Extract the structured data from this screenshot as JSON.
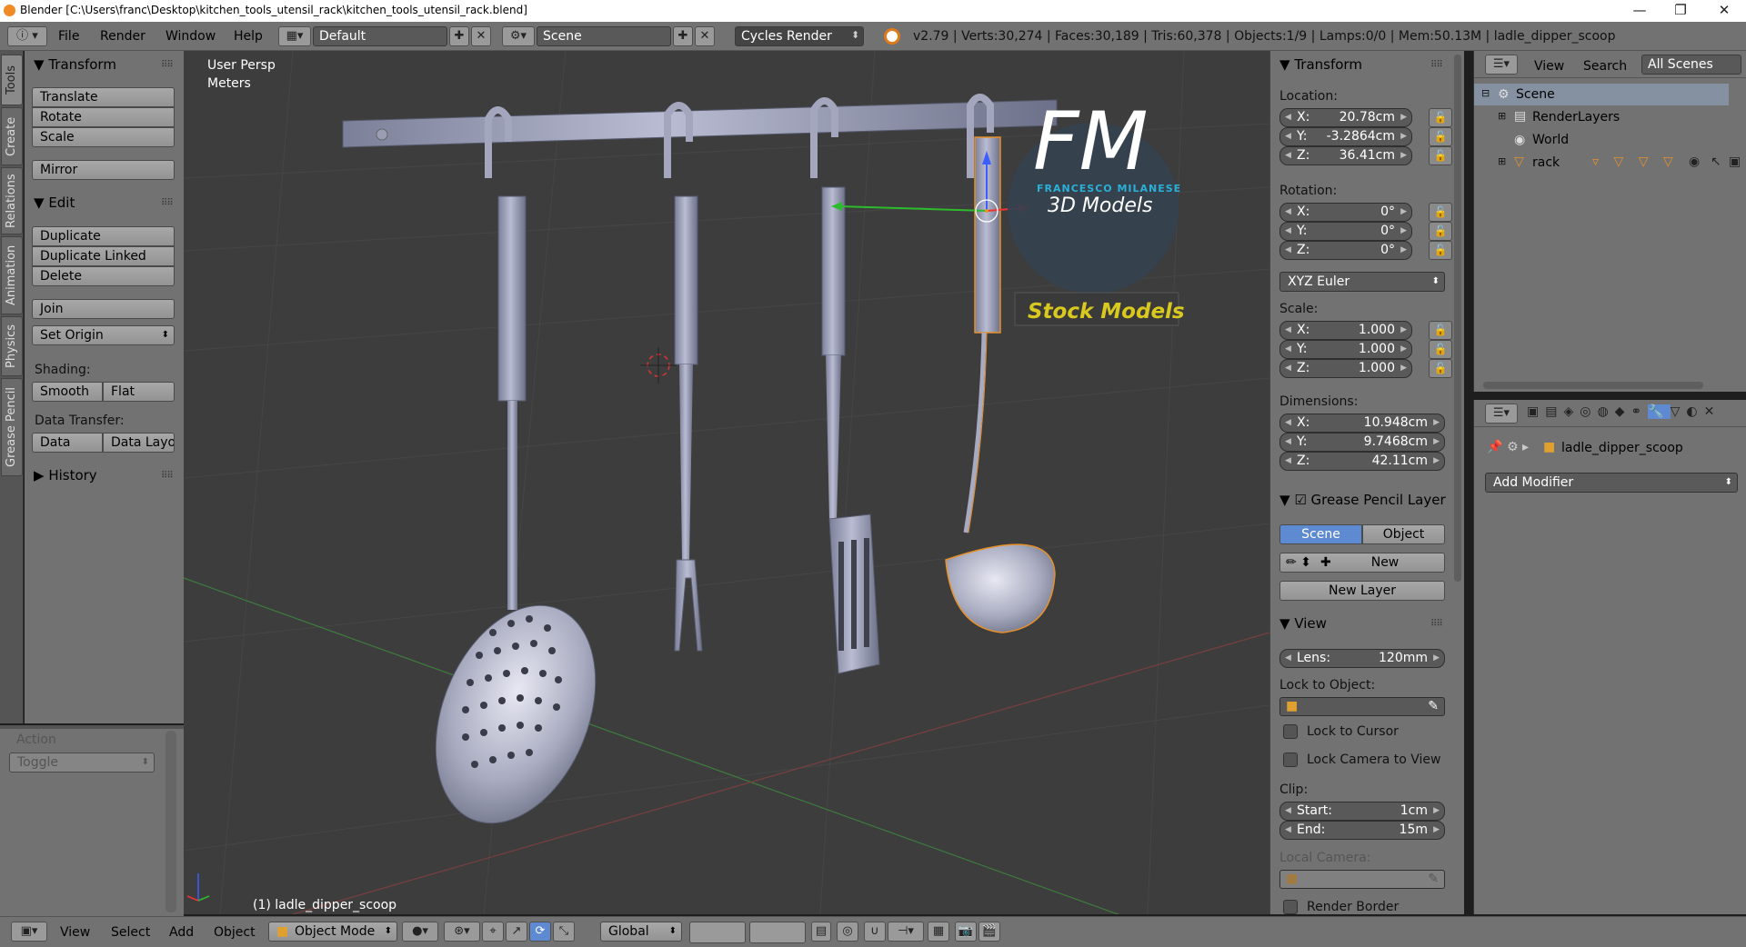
{
  "window": {
    "title": "Blender [C:\\Users\\franc\\Desktop\\kitchen_tools_utensil_rack\\kitchen_tools_utensil_rack.blend]",
    "controls": [
      "—",
      "❐",
      "✕"
    ]
  },
  "header": {
    "menus": [
      "File",
      "Render",
      "Window",
      "Help"
    ],
    "layout": "Default",
    "scene": "Scene",
    "engine": "Cycles Render",
    "stats": "v2.79 | Verts:30,274 | Faces:30,189 | Tris:60,378 | Objects:1/9 | Lamps:0/0 | Mem:50.13M | ladle_dipper_scoop"
  },
  "tabs": [
    "Tools",
    "Create",
    "Relations",
    "Animation",
    "Physics",
    "Grease Pencil"
  ],
  "toolshelf": {
    "transform_title": "Transform",
    "translate": "Translate",
    "rotate": "Rotate",
    "scale": "Scale",
    "mirror": "Mirror",
    "edit_title": "Edit",
    "duplicate": "Duplicate",
    "duplicate_linked": "Duplicate Linked",
    "delete": "Delete",
    "join": "Join",
    "set_origin": "Set Origin",
    "shading_label": "Shading:",
    "smooth": "Smooth",
    "flat": "Flat",
    "data_transfer_label": "Data Transfer:",
    "data": "Data",
    "data_layout": "Data Layo",
    "history": "History"
  },
  "operator_panel": {
    "action_label": "Action",
    "action_value": "Toggle"
  },
  "viewport": {
    "view_name": "User Persp",
    "units": "Meters",
    "active_object": "(1) ladle_dipper_scoop",
    "logo_letters": "FM",
    "logo_name": "FRANCESCO MILANESE",
    "logo_sub": "3D Models",
    "stock": "Stock Models"
  },
  "npanel": {
    "transform_title": "Transform",
    "location_label": "Location:",
    "location": [
      {
        "k": "X:",
        "v": "20.78cm"
      },
      {
        "k": "Y:",
        "v": "-3.2864cm"
      },
      {
        "k": "Z:",
        "v": "36.41cm"
      }
    ],
    "rotation_label": "Rotation:",
    "rotation": [
      {
        "k": "X:",
        "v": "0°"
      },
      {
        "k": "Y:",
        "v": "0°"
      },
      {
        "k": "Z:",
        "v": "0°"
      }
    ],
    "rotation_mode": "XYZ Euler",
    "scale_label": "Scale:",
    "scale": [
      {
        "k": "X:",
        "v": "1.000"
      },
      {
        "k": "Y:",
        "v": "1.000"
      },
      {
        "k": "Z:",
        "v": "1.000"
      }
    ],
    "dimensions_label": "Dimensions:",
    "dimensions": [
      {
        "k": "X:",
        "v": "10.948cm"
      },
      {
        "k": "Y:",
        "v": "9.7468cm"
      },
      {
        "k": "Z:",
        "v": "42.11cm"
      }
    ],
    "gp_title": "Grease Pencil Layer",
    "gp_scene": "Scene",
    "gp_object": "Object",
    "gp_new": "New",
    "gp_new_layer": "New Layer",
    "view_title": "View",
    "lens_label": "Lens:",
    "lens_value": "120mm",
    "lock_object_label": "Lock to Object:",
    "lock_cursor": "Lock to Cursor",
    "lock_camera": "Lock Camera to View",
    "clip_label": "Clip:",
    "clip_start_label": "Start:",
    "clip_start": "1cm",
    "clip_end_label": "End:",
    "clip_end": "15m",
    "local_camera_label": "Local Camera:",
    "render_border": "Render Border"
  },
  "outliner": {
    "view": "View",
    "search": "Search",
    "filter": "All Scenes",
    "items": [
      "Scene",
      "RenderLayers",
      "World",
      "rack"
    ]
  },
  "properties": {
    "object_name": "ladle_dipper_scoop",
    "add_modifier": "Add Modifier"
  },
  "footer": {
    "menus": [
      "View",
      "Select",
      "Add",
      "Object"
    ],
    "mode": "Object Mode",
    "orientation": "Global"
  }
}
